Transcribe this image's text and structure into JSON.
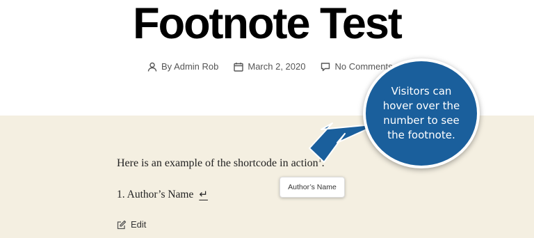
{
  "post": {
    "title": "Footnote Test",
    "meta": {
      "author": "By Admin Rob",
      "date": "March 2, 2020",
      "comments": "No Comments"
    },
    "paragraph_text": "Here is an example of the shortcode in action",
    "footnote_ref": "1",
    "paragraph_end": ".",
    "footnote": {
      "entry": "1. Author’s Name",
      "return_symbol": "↵"
    },
    "tooltip": "Author’s Name",
    "edit_label": "Edit"
  },
  "callout": {
    "text": "Visitors can hover over the number to see the footnote.",
    "color": "#1a5f9c"
  },
  "colors": {
    "content_background": "#f4efe1",
    "header_background": "#ffffff"
  },
  "icons": [
    "person-icon",
    "calendar-icon",
    "comment-icon",
    "edit-icon",
    "return-arrow-icon"
  ]
}
